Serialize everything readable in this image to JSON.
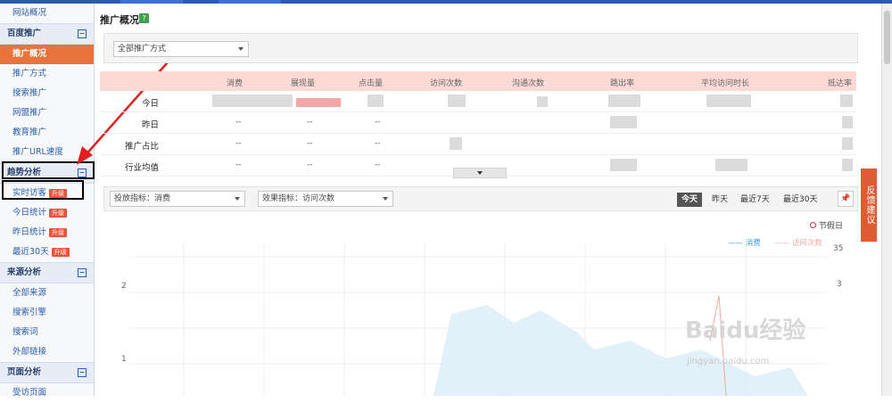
{
  "sidebar": {
    "sections": [
      {
        "key": "top",
        "items": [
          {
            "label": "网站概况"
          }
        ]
      },
      {
        "title": "百度推广",
        "toggle": "⊟",
        "items": [
          {
            "label": "推广概况",
            "active": true
          },
          {
            "label": "推广方式"
          },
          {
            "label": "搜索推广"
          },
          {
            "label": "网盟推广"
          },
          {
            "label": "教育推广"
          },
          {
            "label": "推广URL速度"
          }
        ]
      },
      {
        "title": "趋势分析",
        "toggle": "⊟",
        "items": [
          {
            "label": "实时访客",
            "badge": "升级"
          },
          {
            "label": "今日统计",
            "badge": "升级"
          },
          {
            "label": "昨日统计",
            "badge": "升级"
          },
          {
            "label": "最近30天",
            "badge": "升级"
          }
        ]
      },
      {
        "title": "来源分析",
        "toggle": "⊟",
        "items": [
          {
            "label": "全部来源"
          },
          {
            "label": "搜索引擎"
          },
          {
            "label": "搜索词"
          },
          {
            "label": "外部链接"
          }
        ]
      },
      {
        "title": "页面分析",
        "toggle": "⊟",
        "items": [
          {
            "label": "受访页面"
          }
        ]
      }
    ]
  },
  "main": {
    "title": "推广概况",
    "help_icon": "?",
    "filter_select": "全部推广方式",
    "table": {
      "headers": [
        "消费",
        "展现量",
        "点击量",
        "访问次数",
        "沟通次数",
        "跳出率",
        "平均访问时长",
        "抵达率"
      ],
      "rows": [
        {
          "label": "今日",
          "values": [
            "",
            "",
            "",
            "",
            "",
            "",
            "",
            ""
          ]
        },
        {
          "label": "昨日",
          "values": [
            "--",
            "--",
            "--",
            "",
            "",
            "",
            "",
            ""
          ]
        },
        {
          "label": "推广占比",
          "values": [
            "--",
            "--",
            "--",
            "",
            "",
            "",
            "",
            ""
          ]
        },
        {
          "label": "行业均值",
          "values": [
            "--",
            "--",
            "--",
            "",
            "",
            "",
            "",
            ""
          ]
        }
      ]
    },
    "chart_panel": {
      "select_invest": "投放指标：消费",
      "select_effect": "效果指标：访问次数",
      "range_buttons": [
        "今天",
        "昨天",
        "最近7天",
        "最近30天"
      ],
      "active_range": "今天",
      "holiday_label": "节假日",
      "legend": [
        {
          "name": "消费",
          "color": "#3aa0e0"
        },
        {
          "name": "访问次数",
          "color": "#f0a8a0"
        }
      ],
      "right_ticks": [
        "35",
        "3"
      ],
      "left_ticks": [
        "2",
        "1"
      ]
    },
    "feedback": "反馈建议",
    "watermark": "Baidu经验",
    "watermark_url": "jingyan.baidu.com"
  },
  "colors": {
    "accent": "#e8743b",
    "nav": "#2a5caa",
    "header_row": "#fbd9d5"
  }
}
